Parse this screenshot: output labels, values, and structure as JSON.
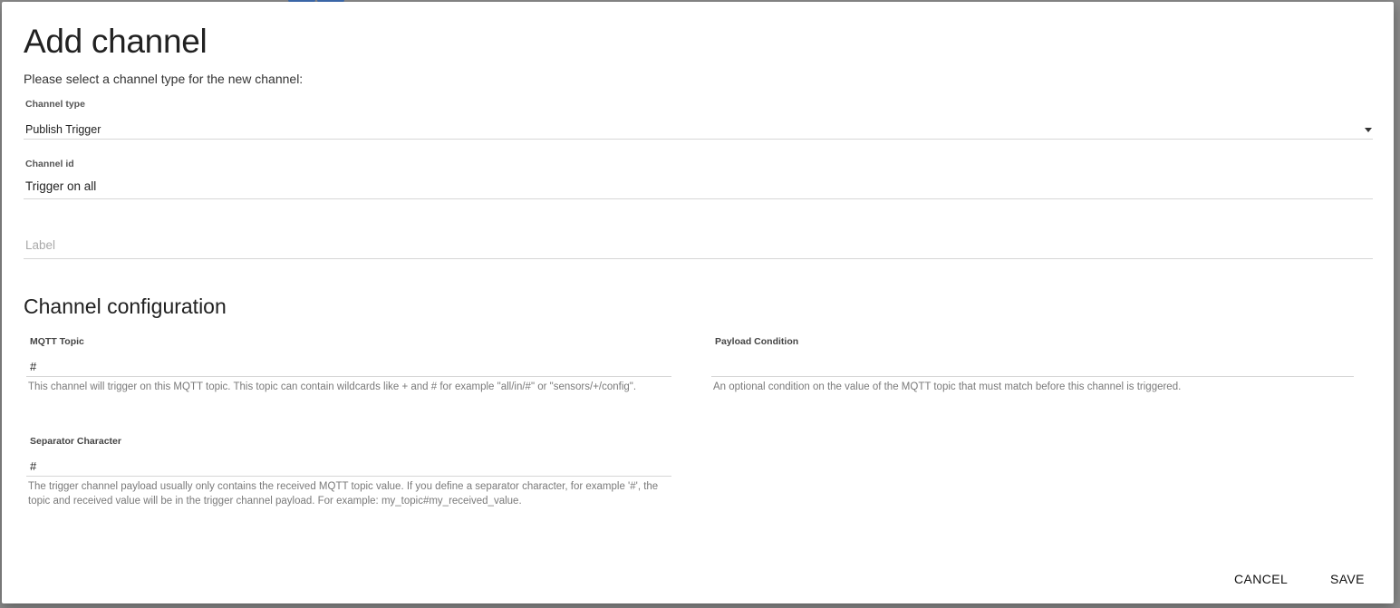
{
  "dialog": {
    "title": "Add channel",
    "subtitle": "Please select a channel type for the new channel:"
  },
  "channel_type": {
    "label": "Channel type",
    "value": "Publish Trigger",
    "dropdown_icon": "caret-down-icon"
  },
  "channel_id": {
    "label": "Channel id",
    "value": "Trigger on all"
  },
  "label_field": {
    "placeholder": "Label"
  },
  "configuration": {
    "title": "Channel configuration",
    "mqtt_topic": {
      "label": "MQTT Topic",
      "value": "#",
      "help": "This channel will trigger on this MQTT topic. This topic can contain wildcards like + and # for example \"all/in/#\" or \"sensors/+/config\"."
    },
    "payload_condition": {
      "label": "Payload Condition",
      "value": "",
      "help": "An optional condition on the value of the MQTT topic that must match before this channel is triggered."
    },
    "separator": {
      "label": "Separator Character",
      "value": "#",
      "help": "The trigger channel payload usually only contains the received MQTT topic value. If you define a separator character, for example '#', the topic and received value will be in the trigger channel payload. For example: my_topic#my_received_value."
    }
  },
  "actions": {
    "cancel": "Cancel",
    "save": "Save"
  }
}
